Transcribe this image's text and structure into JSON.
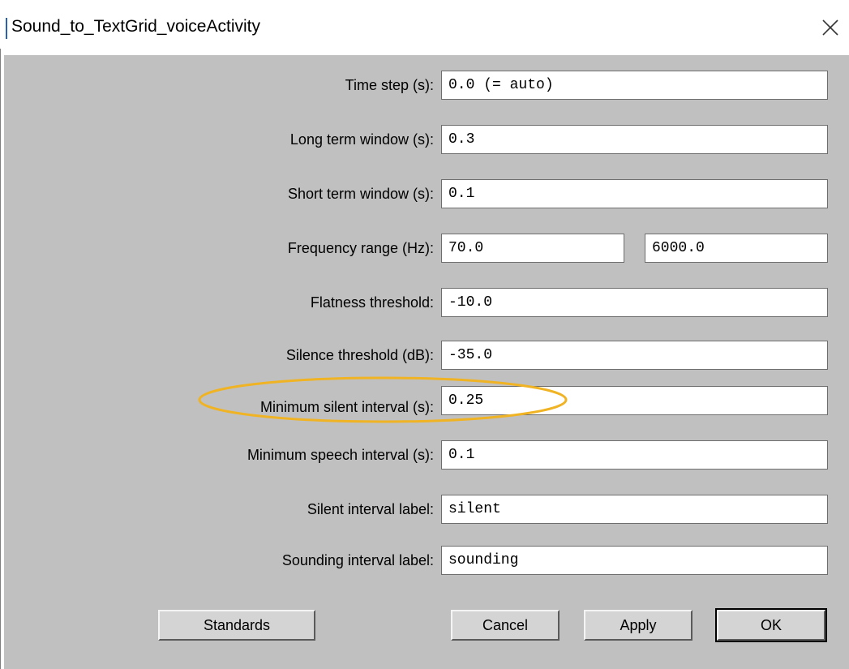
{
  "window": {
    "title": "Sound_to_TextGrid_voiceActivity",
    "close_icon": "close-icon"
  },
  "fields": [
    {
      "label": "Time step (s):",
      "value": "0.0 (= auto)"
    },
    {
      "label": "Long term window (s):",
      "value": "0.3"
    },
    {
      "label": "Short term window (s):",
      "value": "0.1"
    },
    {
      "label": "Frequency range (Hz):",
      "value": "70.0",
      "value2": "6000.0"
    },
    {
      "label": "Flatness threshold:",
      "value": "-10.0"
    },
    {
      "label": "Silence threshold (dB):",
      "value": "-35.0"
    },
    {
      "label": "Minimum silent interval (s):",
      "value": "0.25"
    },
    {
      "label": "Minimum speech interval (s):",
      "value": "0.1"
    },
    {
      "label": "Silent interval label:",
      "value": "silent"
    },
    {
      "label": "Sounding interval label:",
      "value": "sounding"
    }
  ],
  "buttons": {
    "standards": "Standards",
    "cancel": "Cancel",
    "apply": "Apply",
    "ok": "OK"
  },
  "annotation": {
    "highlight_color": "#f0b323",
    "highlighted_field": "Minimum silent interval (s):"
  },
  "colors": {
    "dialog_background": "#c0c0c0",
    "title_accent": "#2b5fb0"
  }
}
